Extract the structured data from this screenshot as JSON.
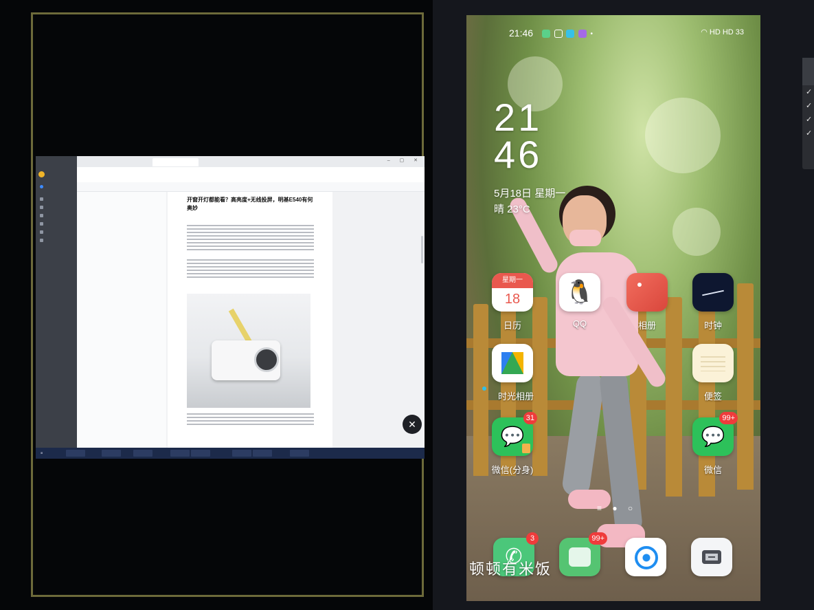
{
  "pc": {
    "tabs": [
      "",
      "",
      "",
      ""
    ],
    "doc": {
      "title": "开窗开灯都能看？高亮度+无线投屏，明基E540有何奥妙"
    }
  },
  "phone": {
    "status": {
      "time": "21:46",
      "right_text": "HD HD 33"
    },
    "clock_hour": "21",
    "clock_min": "46",
    "date": "5月18日 星期一",
    "weather": "晴 23°C",
    "apps": [
      {
        "name": "calendar",
        "label": "日历",
        "icon_top": "星期一",
        "icon_day": "18"
      },
      {
        "name": "qq",
        "label": "QQ"
      },
      {
        "name": "album",
        "label": "相册"
      },
      {
        "name": "clock",
        "label": "时钟"
      },
      {
        "name": "timeline-album",
        "label": "时光相册"
      },
      {
        "name": "memo",
        "label": "便签"
      },
      {
        "name": "wechat-dual",
        "label": "微信(分身)",
        "badge": "31"
      },
      {
        "name": "wechat",
        "label": "微信",
        "badge": "99+"
      }
    ],
    "dock": {
      "overlay_text": "顿顿有米饭",
      "phone_badge": "3",
      "multi_badge": "99+"
    },
    "page_indicator": "≡ ● ○"
  },
  "colors": {
    "badge": "#ef3b3b",
    "wechat": "#2dc15a",
    "calendar": "#e9584e"
  }
}
